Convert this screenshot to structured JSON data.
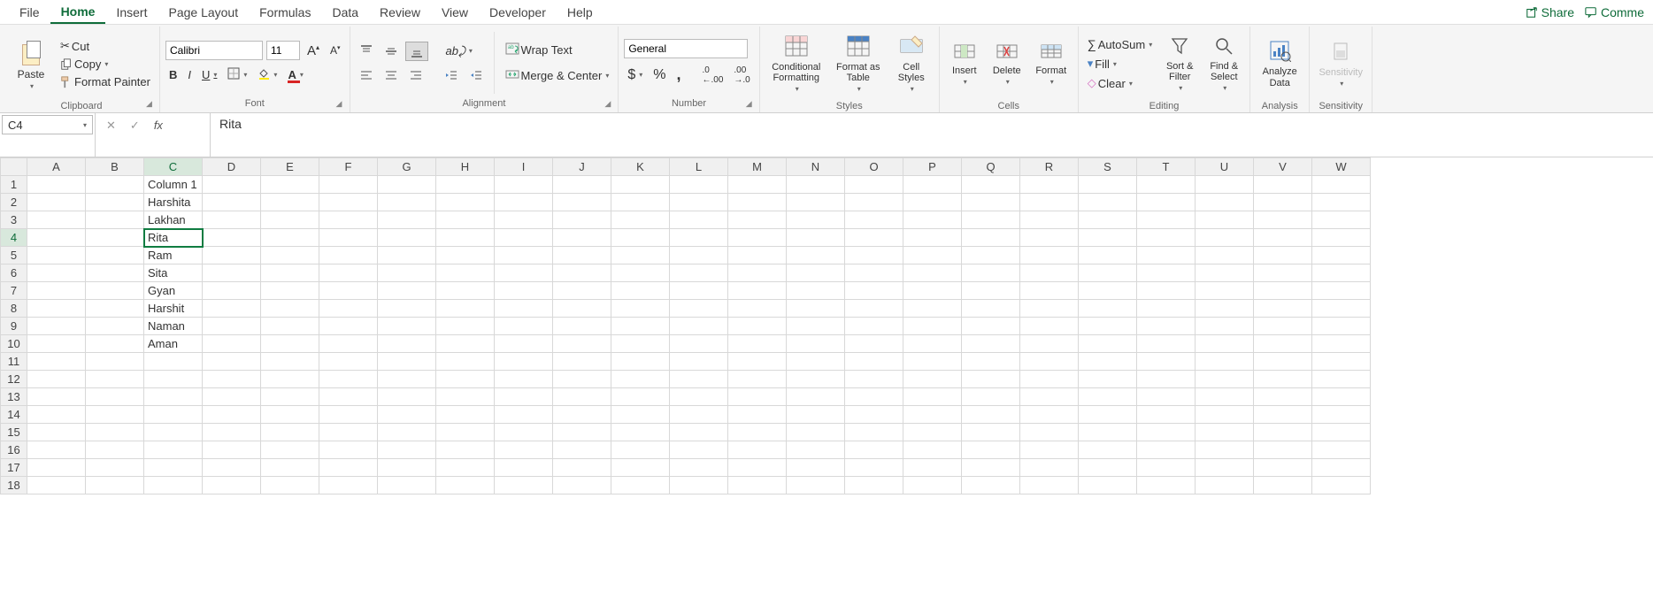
{
  "tabs": [
    "File",
    "Home",
    "Insert",
    "Page Layout",
    "Formulas",
    "Data",
    "Review",
    "View",
    "Developer",
    "Help"
  ],
  "active_tab": "Home",
  "share_label": "Share",
  "comments_label": "Comme",
  "clipboard": {
    "paste": "Paste",
    "cut": "Cut",
    "copy": "Copy",
    "format_painter": "Format Painter",
    "group": "Clipboard"
  },
  "font": {
    "name": "Calibri",
    "size": "11",
    "group": "Font"
  },
  "alignment": {
    "wrap": "Wrap Text",
    "merge": "Merge & Center",
    "group": "Alignment"
  },
  "number": {
    "format": "General",
    "group": "Number"
  },
  "styles": {
    "cond": "Conditional Formatting",
    "table": "Format as Table",
    "cells": "Cell Styles",
    "group": "Styles"
  },
  "cells_grp": {
    "insert": "Insert",
    "delete": "Delete",
    "format": "Format",
    "group": "Cells"
  },
  "editing": {
    "autosum": "AutoSum",
    "fill": "Fill",
    "clear": "Clear",
    "sort": "Sort & Filter",
    "find": "Find & Select",
    "group": "Editing"
  },
  "analysis": {
    "analyze": "Analyze Data",
    "group": "Analysis"
  },
  "sensitivity": {
    "label": "Sensitivity",
    "group": "Sensitivity"
  },
  "namebox": "C4",
  "formula": "Rita",
  "columns": [
    "A",
    "B",
    "C",
    "D",
    "E",
    "F",
    "G",
    "H",
    "I",
    "J",
    "K",
    "L",
    "M",
    "N",
    "O",
    "P",
    "Q",
    "R",
    "S",
    "T",
    "U",
    "V",
    "W"
  ],
  "rows": 18,
  "selected_cell": {
    "col": "C",
    "row": 4
  },
  "data": {
    "C1": "Column 1",
    "C2": "Harshita",
    "C3": "Lakhan",
    "C4": "Rita",
    "C5": "Ram",
    "C6": "Sita",
    "C7": "Gyan",
    "C8": "Harshit",
    "C9": "Naman",
    "C10": "Aman"
  }
}
